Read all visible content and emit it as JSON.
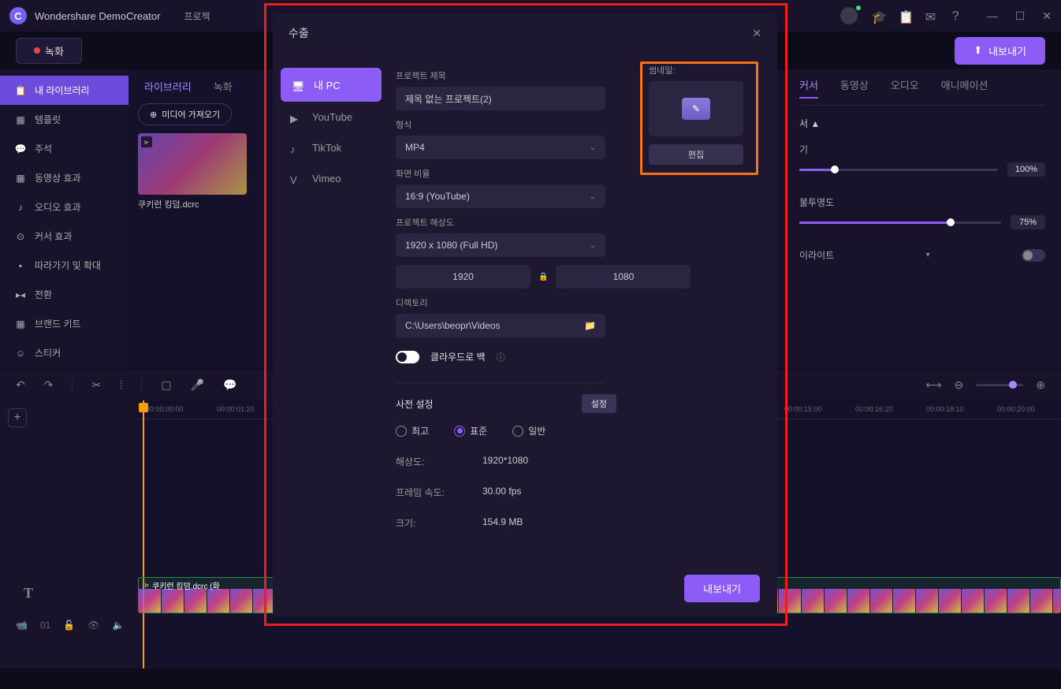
{
  "app": {
    "title": "Wondershare DemoCreator",
    "menu": [
      "프로젝"
    ]
  },
  "toolbar": {
    "record": "녹화",
    "export": "내보내기"
  },
  "sidebar": {
    "items": [
      {
        "label": "내 라이브러리",
        "icon": "📋"
      },
      {
        "label": "템플릿",
        "icon": "▦"
      },
      {
        "label": "주석",
        "icon": "💬"
      },
      {
        "label": "동영상 효과",
        "icon": "▦"
      },
      {
        "label": "오디오 효과",
        "icon": "♪"
      },
      {
        "label": "커서 효과",
        "icon": "⊙"
      },
      {
        "label": "따라가기 및 확대",
        "icon": "▪"
      },
      {
        "label": "전환",
        "icon": "▸◂"
      },
      {
        "label": "브랜드 키트",
        "icon": "▦"
      },
      {
        "label": "스티커",
        "icon": "☺"
      }
    ]
  },
  "library": {
    "tabs": [
      "라이브러리",
      "녹화"
    ],
    "import": "미디어 가져오기",
    "thumb_label": "쿠키런 킹덤.dcrc"
  },
  "props": {
    "tabs": [
      "커서",
      "동영상",
      "오디오",
      "애니메이션"
    ],
    "header": "서 ▲",
    "size_label": "기",
    "size_value": "100%",
    "opacity_label": "불투명도",
    "opacity_value": "75%",
    "highlight_label": "이라이트"
  },
  "timeline": {
    "marks": [
      "00:00:00:00",
      "00:00:01:20",
      "00:00:15:00",
      "00:00:16:20",
      "00:00:18:10",
      "00:00:20:00"
    ],
    "clip_label": "쿠키런 킹덤.dcrc (화",
    "track_badge": "01"
  },
  "modal": {
    "title": "수출",
    "sidebar": [
      {
        "label": "내 PC",
        "active": true
      },
      {
        "label": "YouTube"
      },
      {
        "label": "TikTok"
      },
      {
        "label": "Vimeo"
      }
    ],
    "fields": {
      "project_title_label": "프로젝트 제목",
      "project_title_value": "제목 없는 프로젝트(2)",
      "format_label": "형식",
      "format_value": "MP4",
      "aspect_label": "화면 비율",
      "aspect_value": "16:9 (YouTube)",
      "resolution_label": "프로젝트 해상도",
      "resolution_value": "1920 x 1080 (Full HD)",
      "width": "1920",
      "height": "1080",
      "directory_label": "디렉토리",
      "directory_value": "C:\\Users\\beopr\\Videos",
      "cloud_label": "클라우드로 백",
      "preset_label": "사전 설정",
      "preset_btn": "설정",
      "radio_best": "최고",
      "radio_standard": "표준",
      "radio_normal": "일반",
      "info_resolution_label": "해상도:",
      "info_resolution_value": "1920*1080",
      "info_fps_label": "프레임 속도:",
      "info_fps_value": "30.00 fps",
      "info_size_label": "크기:",
      "info_size_value": "154.9 MB"
    },
    "thumbnail": {
      "label": "썸네일:",
      "edit_btn": "편집"
    },
    "export_btn": "내보내기"
  }
}
